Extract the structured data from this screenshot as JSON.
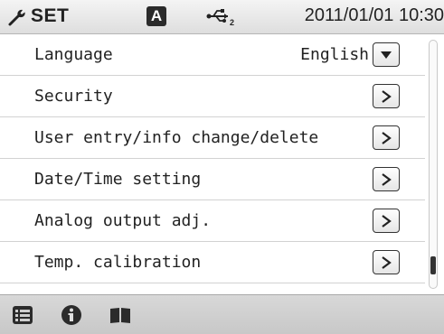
{
  "header": {
    "title": "SET",
    "mode_badge": "A",
    "datetime": "2011/01/01 10:30",
    "icons": [
      "wrench-icon",
      "usb-icon"
    ]
  },
  "settings": {
    "items": [
      {
        "label": "Language",
        "value": "English",
        "control": "dropdown"
      },
      {
        "label": "Security",
        "control": "arrow"
      },
      {
        "label": "User entry/info change/delete",
        "control": "arrow"
      },
      {
        "label": "Date/Time setting",
        "control": "arrow"
      },
      {
        "label": "Analog output adj.",
        "control": "arrow"
      },
      {
        "label": "Temp. calibration",
        "control": "arrow"
      }
    ]
  },
  "scrollbar": {
    "position_fraction": 0.95
  },
  "footer": {
    "icons": [
      "list-icon",
      "info-icon",
      "manual-icon"
    ]
  },
  "colors": {
    "header_bg": "#e6e6e6",
    "footer_bg": "#cfcfcf",
    "text": "#222222",
    "badge": "#2b2b2b"
  }
}
